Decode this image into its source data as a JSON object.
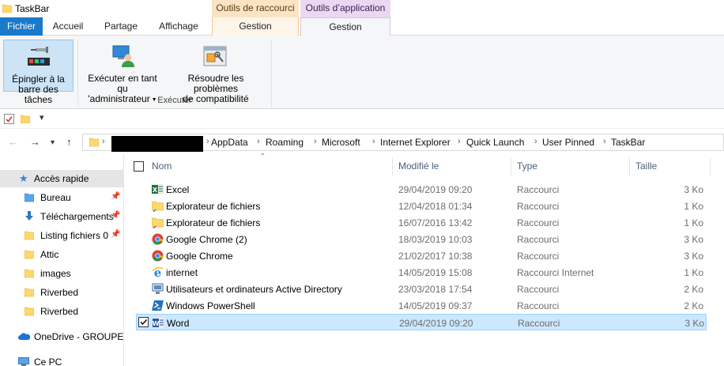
{
  "window": {
    "title": "TaskBar"
  },
  "context_tabs": {
    "shortcut_tools": "Outils de raccourci",
    "app_tools": "Outils d’application"
  },
  "ribbon_tabs": {
    "file": "Fichier",
    "home": "Accueil",
    "share": "Partage",
    "view": "Affichage",
    "manage_shortcut": "Gestion",
    "manage_app": "Gestion"
  },
  "ribbon": {
    "pin_line1": "Épingler à la",
    "pin_line2": "barre des tâches",
    "run_admin_line1": "Exécuter en tant qu",
    "run_admin_line2": "'administrateur",
    "compat_line1": "Résoudre les problèmes",
    "compat_line2": "de compatibilité",
    "group_label": "Exécuter"
  },
  "breadcrumb": [
    "AppData",
    "Roaming",
    "Microsoft",
    "Internet Explorer",
    "Quick Launch",
    "User Pinned",
    "TaskBar"
  ],
  "nav": {
    "quick_access": "Accès rapide",
    "items": [
      "Bureau",
      "Téléchargements",
      "Listing fichiers 0",
      "Attic",
      "images",
      "Riverbed",
      "Riverbed"
    ],
    "onedrive": "OneDrive - GROUPE L",
    "this_pc": "Ce PC"
  },
  "columns": {
    "name": "Nom",
    "modified": "Modifié le",
    "type": "Type",
    "size": "Taille"
  },
  "files": [
    {
      "name": "Excel",
      "date": "29/04/2019 09:20",
      "type": "Raccourci",
      "size": "3 Ko",
      "icon": "excel-icon"
    },
    {
      "name": "Explorateur de fichiers",
      "date": "12/04/2018 01:34",
      "type": "Raccourci",
      "size": "1 Ko",
      "icon": "folder-icon"
    },
    {
      "name": "Explorateur de fichiers",
      "date": "16/07/2016 13:42",
      "type": "Raccourci",
      "size": "1 Ko",
      "icon": "folder-icon"
    },
    {
      "name": "Google Chrome (2)",
      "date": "18/03/2019 10:03",
      "type": "Raccourci",
      "size": "3 Ko",
      "icon": "chrome-icon"
    },
    {
      "name": "Google Chrome",
      "date": "21/02/2017 10:38",
      "type": "Raccourci",
      "size": "3 Ko",
      "icon": "chrome-icon"
    },
    {
      "name": "internet",
      "date": "14/05/2019 15:08",
      "type": "Raccourci Internet",
      "size": "1 Ko",
      "icon": "internet-explorer-icon"
    },
    {
      "name": "Utilisateurs et ordinateurs Active Directory",
      "date": "23/03/2018 17:54",
      "type": "Raccourci",
      "size": "2 Ko",
      "icon": "active-directory-icon"
    },
    {
      "name": "Windows PowerShell",
      "date": "14/05/2019 09:37",
      "type": "Raccourci",
      "size": "2 Ko",
      "icon": "powershell-icon"
    },
    {
      "name": "Word",
      "date": "29/04/2019 09:20",
      "type": "Raccourci",
      "size": "3 Ko",
      "icon": "word-icon",
      "selected": true
    }
  ]
}
